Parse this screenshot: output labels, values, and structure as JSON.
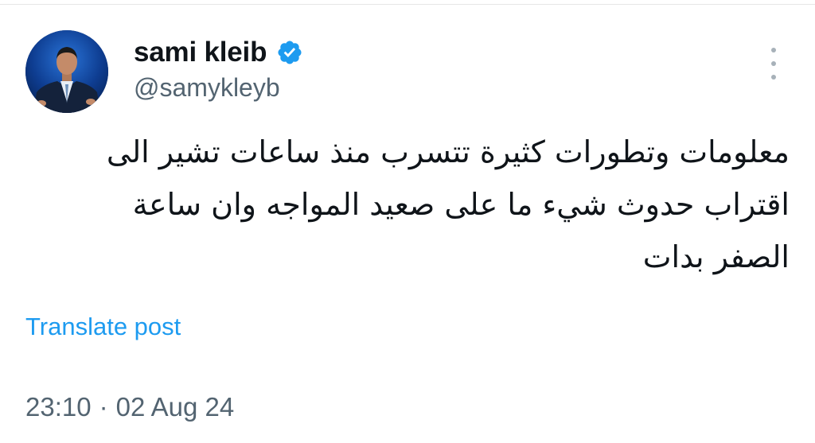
{
  "tweet": {
    "author": {
      "display_name": "sami kleib",
      "handle": "@samykleyb",
      "verified": true,
      "avatar_icon": "profile-photo"
    },
    "more_icon": "vertical-ellipsis-icon",
    "text": "معلومات وتطورات كثيرة تتسرب منذ ساعات تشير الى\nاقتراب حدوث شيء ما على صعيد المواجه وان ساعة\nالصفر بدات",
    "translate_label": "Translate post",
    "time": "23:10",
    "separator": "·",
    "date": "02 Aug 24"
  },
  "colors": {
    "accent": "#1d9bf0",
    "verified_badge": "#1d9bf0",
    "secondary_text": "#536471",
    "primary_text": "#0f1419",
    "background": "#ffffff"
  }
}
